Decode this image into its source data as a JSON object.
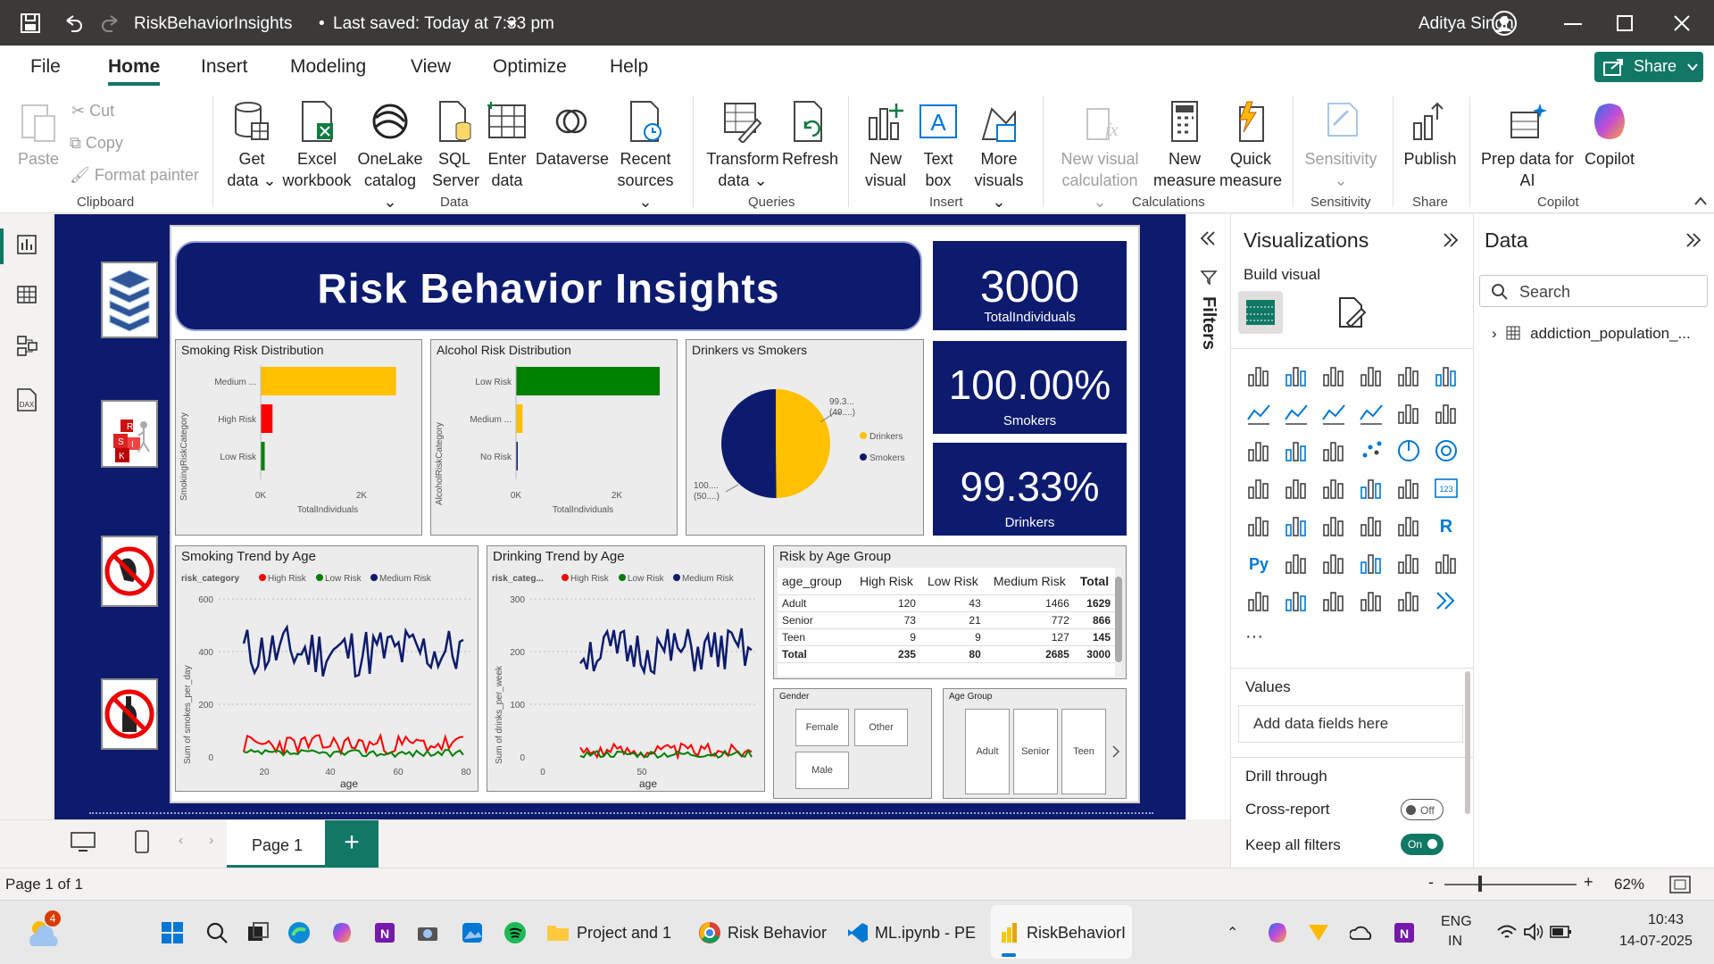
{
  "titlebar": {
    "title": "RiskBehaviorInsights",
    "saved": "Last saved: Today at 7:33 pm",
    "user": "Aditya Singh"
  },
  "menu": [
    "File",
    "Home",
    "Insert",
    "Modeling",
    "View",
    "Optimize",
    "Help"
  ],
  "share": "Share",
  "ribbon": {
    "clipboard": {
      "paste": "Paste",
      "cut": "Cut",
      "copy": "Copy",
      "format": "Format painter",
      "group": "Clipboard"
    },
    "data": {
      "get1": "Get",
      "get2": "data",
      "excel1": "Excel",
      "excel2": "workbook",
      "onelake1": "OneLake",
      "onelake2": "catalog",
      "sql1": "SQL",
      "sql2": "Server",
      "enter1": "Enter",
      "enter2": "data",
      "dataverse": "Dataverse",
      "recent1": "Recent",
      "recent2": "sources",
      "group": "Data"
    },
    "queries": {
      "transform1": "Transform",
      "transform2": "data",
      "refresh": "Refresh",
      "group": "Queries"
    },
    "insert": {
      "nv1": "New",
      "nv2": "visual",
      "tb1": "Text",
      "tb2": "box",
      "mv1": "More",
      "mv2": "visuals",
      "group": "Insert"
    },
    "calc": {
      "nvc1": "New visual",
      "nvc2": "calculation",
      "nm1": "New",
      "nm2": "measure",
      "qm1": "Quick",
      "qm2": "measure",
      "group": "Calculations"
    },
    "sens": {
      "label": "Sensitivity",
      "group": "Sensitivity"
    },
    "shareg": {
      "publish": "Publish",
      "group": "Share"
    },
    "copilot": {
      "prep1": "Prep data for",
      "prep2": "AI",
      "copilot": "Copilot",
      "group": "Copilot"
    }
  },
  "report": {
    "title": "Risk Behavior Insights",
    "kpis": [
      {
        "value": "3000",
        "label": "TotalIndividuals"
      },
      {
        "value": "100.00%",
        "label": "Smokers"
      },
      {
        "value": "99.33%",
        "label": "Drinkers"
      }
    ],
    "smoking": {
      "title": "Smoking Risk Distribution",
      "yaxis": "SmokingRiskCategory",
      "xaxis": "TotalIndividuals",
      "ticks": [
        "0K",
        "2K"
      ],
      "cats": [
        "Medium ...",
        "High Risk",
        "Low Risk"
      ]
    },
    "alcohol": {
      "title": "Alcohol Risk Distribution",
      "yaxis": "AlcoholRiskCategory",
      "xaxis": "TotalIndividuals",
      "ticks": [
        "0K",
        "2K"
      ],
      "cats": [
        "Low Risk",
        "Medium ...",
        "No Risk"
      ]
    },
    "pie": {
      "title": "Drinkers vs Smokers",
      "lab1a": "99.3...",
      "lab1b": "(49....)",
      "lab2a": "100....",
      "lab2b": "(50....)",
      "leg1": "Drinkers",
      "leg2": "Smokers"
    },
    "strend": {
      "title": "Smoking Trend by Age",
      "legtitle": "risk_category",
      "leg": [
        "High Risk",
        "Low Risk",
        "Medium Risk"
      ],
      "ylabel": "Sum of smokes_per_day",
      "xlabel": "age",
      "yticks": [
        "600",
        "400",
        "200",
        "0"
      ],
      "xticks": [
        "20",
        "40",
        "60",
        "80"
      ]
    },
    "dtrend": {
      "title": "Drinking Trend by Age",
      "legtitle": "risk_categ...",
      "leg": [
        "High Risk",
        "Low Risk",
        "Medium Risk"
      ],
      "ylabel": "Sum of drinks_per_week",
      "xlabel": "age",
      "yticks": [
        "300",
        "200",
        "100",
        "0"
      ],
      "xticks": [
        "0",
        "50"
      ]
    },
    "matrix": {
      "title": "Risk by Age Group",
      "headers": [
        "age_group",
        "High Risk",
        "Low Risk",
        "Medium Risk",
        "Total"
      ],
      "rows": [
        [
          "Adult",
          "120",
          "43",
          "1466",
          "1629"
        ],
        [
          "Senior",
          "73",
          "21",
          "772",
          "866"
        ],
        [
          "Teen",
          "9",
          "9",
          "127",
          "145"
        ],
        [
          "Total",
          "235",
          "80",
          "2685",
          "3000"
        ]
      ]
    },
    "gender": {
      "title": "Gender",
      "opts": [
        "Female",
        "Other",
        "Male"
      ]
    },
    "agegroup": {
      "title": "Age Group",
      "opts": [
        "Adult",
        "Senior",
        "Teen"
      ]
    }
  },
  "chart_data": [
    {
      "type": "bar",
      "title": "Smoking Risk Distribution",
      "categories": [
        "Medium ...",
        "High Risk",
        "Low Risk"
      ],
      "values": [
        2685,
        235,
        80
      ],
      "xlabel": "TotalIndividuals",
      "ylabel": "SmokingRiskCategory",
      "xlim": [
        0,
        2900
      ],
      "colors": [
        "#ffc000",
        "#ff0000",
        "#008000"
      ]
    },
    {
      "type": "bar",
      "title": "Alcohol Risk Distribution",
      "categories": [
        "Low Risk",
        "Medium ...",
        "No Risk"
      ],
      "values": [
        2850,
        130,
        20
      ],
      "xlabel": "TotalIndividuals",
      "ylabel": "AlcoholRiskCategory",
      "xlim": [
        0,
        2900
      ],
      "colors": [
        "#008000",
        "#ffc000",
        "#0d1b6e"
      ]
    },
    {
      "type": "pie",
      "title": "Drinkers vs Smokers",
      "categories": [
        "Drinkers",
        "Smokers"
      ],
      "values": [
        2980,
        3000
      ],
      "colors": [
        "#ffc000",
        "#0d1b6e"
      ]
    }
  ],
  "panes": {
    "filters": "Filters",
    "viz": {
      "title": "Visualizations",
      "build": "Build visual",
      "values": "Values",
      "add": "Add data fields here",
      "drill": "Drill through",
      "cross": "Cross-report",
      "crossState": "Off",
      "keep": "Keep all filters",
      "keepState": "On"
    },
    "data": {
      "title": "Data",
      "search": "Search",
      "table": "addiction_population_..."
    }
  },
  "pages": {
    "page1": "Page 1",
    "status": "Page 1 of 1",
    "zoom": "62%"
  },
  "taskbar": {
    "badge": "4",
    "project": "Project and 1",
    "risk": "Risk Behavior",
    "ml": "ML.ipynb - PE",
    "rbi": "RiskBehaviorI",
    "lang1": "ENG",
    "lang2": "IN",
    "time": "10:43",
    "date": "14-07-2025"
  }
}
